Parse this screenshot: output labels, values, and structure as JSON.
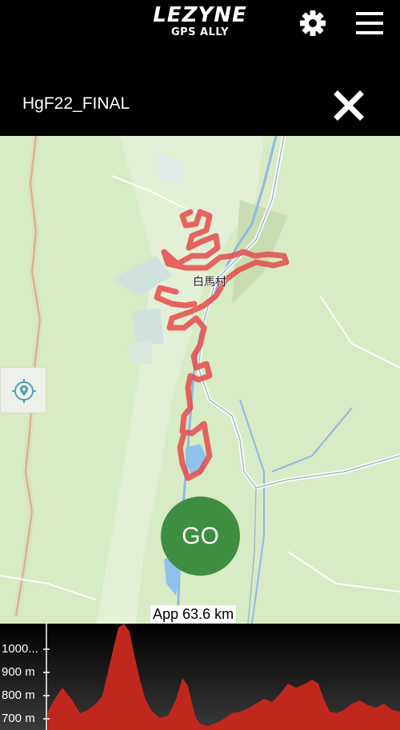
{
  "header": {
    "brand": "LEZYNE",
    "product": "GPS ALLY",
    "settings_icon": "gear-icon",
    "menu_icon": "hamburger-menu-icon"
  },
  "route": {
    "name": "HgF22_FINAL",
    "close_icon": "close-icon"
  },
  "map": {
    "town_label": "白馬村",
    "locate_icon": "location-target-icon",
    "go_label": "GO",
    "distance_label": "App 63.6 km",
    "route_color": "#e54b4b"
  },
  "elevation": {
    "tick_labels": [
      "1000...",
      "900 m",
      "800 m",
      "700 m"
    ],
    "fill_color": "#c0281d"
  }
}
